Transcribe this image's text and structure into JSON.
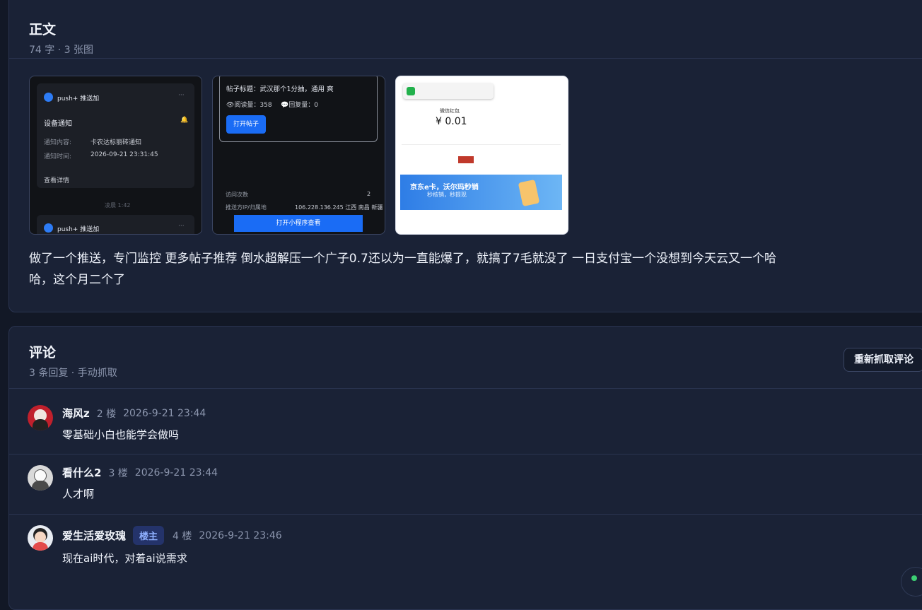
{
  "post": {
    "title": "正文",
    "subtitle": "74 字 · 3 张图",
    "text": "做了一个推送，专门监控 更多帖子推荐 倒水超解压一个广子0.7还以为一直能爆了，就搞了7毛就没了 一日支付宝一个没想到今天云又一个哈哈，这个月二个了",
    "images": [
      {
        "app_name": "push+ 推送加",
        "card_title": "设备通知",
        "row1_label": "通知内容:",
        "row1_value": "卡农达标丽砖通知",
        "row2_label": "通知时间:",
        "row2_value": "2026-09-21 23:31:45",
        "details": "查看详情",
        "time_sep": "凌晨 1:42",
        "app_name_2": "push+ 推送加"
      },
      {
        "topic": "帖子标题：武汉那个1分抽，通用 爽",
        "views_label": "👁阅读量：358",
        "replies_label": "💬回复量：0",
        "open_button": "打开帖子",
        "visits_label": "访问次数",
        "visits_value": "2",
        "ip_label": "推送方IP/归属地",
        "ip_value": "106.228.136.245 江西 南昌 新疆",
        "mini_button": "打开小程序查看"
      },
      {
        "amount_label": "微信红包",
        "amount": "¥ 0.01",
        "banner_title": "京东e卡，沃尔玛秒销",
        "banner_sub": "秒核销，秒提现",
        "accent": "#2c7be5"
      }
    ]
  },
  "comments": {
    "title": "评论",
    "subtitle": "3 条回复 · 手动抓取",
    "refresh_label": "重新抓取评论",
    "items": [
      {
        "name": "海风z",
        "floor": "2 楼",
        "time": "2026-9-21 23:44",
        "text": "零基础小白也能学会做吗",
        "badge": ""
      },
      {
        "name": "看什么2",
        "floor": "3 楼",
        "time": "2026-9-21 23:44",
        "text": "人才啊",
        "badge": ""
      },
      {
        "name": "爱生活爱玫瑰",
        "floor": "4 楼",
        "time": "2026-9-21 23:46",
        "text": "现在ai时代，对着ai说需求",
        "badge": "楼主"
      }
    ]
  }
}
